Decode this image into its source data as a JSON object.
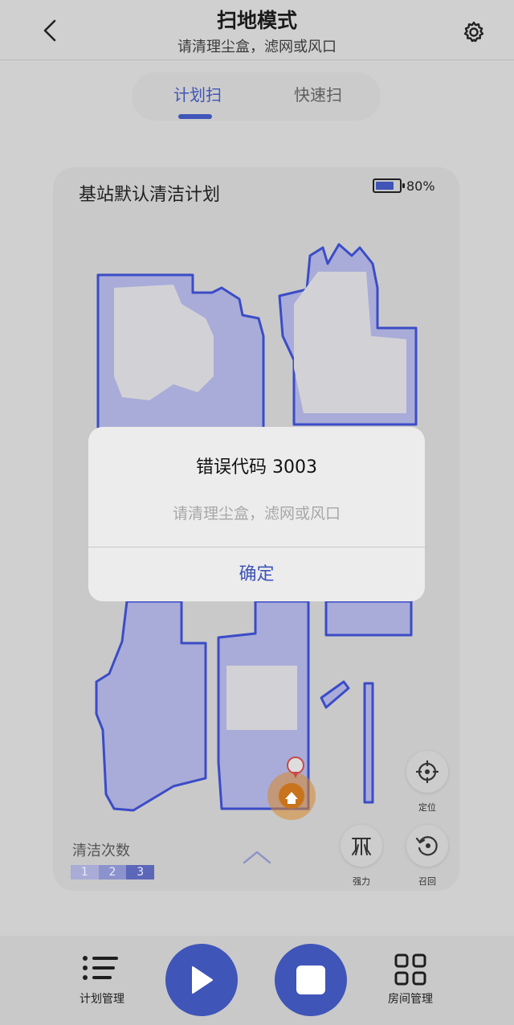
{
  "header": {
    "title": "扫地模式",
    "subtitle": "请清理尘盒，滤网或风口",
    "back_icon": "chevron-left-icon",
    "settings_icon": "gear-icon"
  },
  "tabs": [
    {
      "label": "计划扫",
      "active": true
    },
    {
      "label": "快速扫",
      "active": false
    }
  ],
  "map_card": {
    "plan_title": "基站默认清洁计划",
    "battery_level": 0.8,
    "battery_text": "80%",
    "clean_count_label": "清洁次数",
    "clean_count_steps": [
      "1",
      "2",
      "3"
    ],
    "selected_count": "3",
    "controls": {
      "locate": {
        "label": "定位",
        "icon": "crosshair-icon"
      },
      "power": {
        "label": "强力",
        "icon": "suction-power-icon"
      },
      "recall": {
        "label": "召回",
        "icon": "return-icon"
      }
    }
  },
  "dialog": {
    "title": "错误代码 3003",
    "message": "请清理尘盒，滤网或风口",
    "confirm_label": "确定"
  },
  "bottom_nav": {
    "plan_manage_label": "计划管理",
    "room_manage_label": "房间管理",
    "play_icon": "play-icon",
    "stop_icon": "stop-icon"
  },
  "colors": {
    "accent": "#3f55b8",
    "map_outline": "#3b4cc7",
    "map_fill": "#a9acd8",
    "home_marker": "#d7882a"
  }
}
